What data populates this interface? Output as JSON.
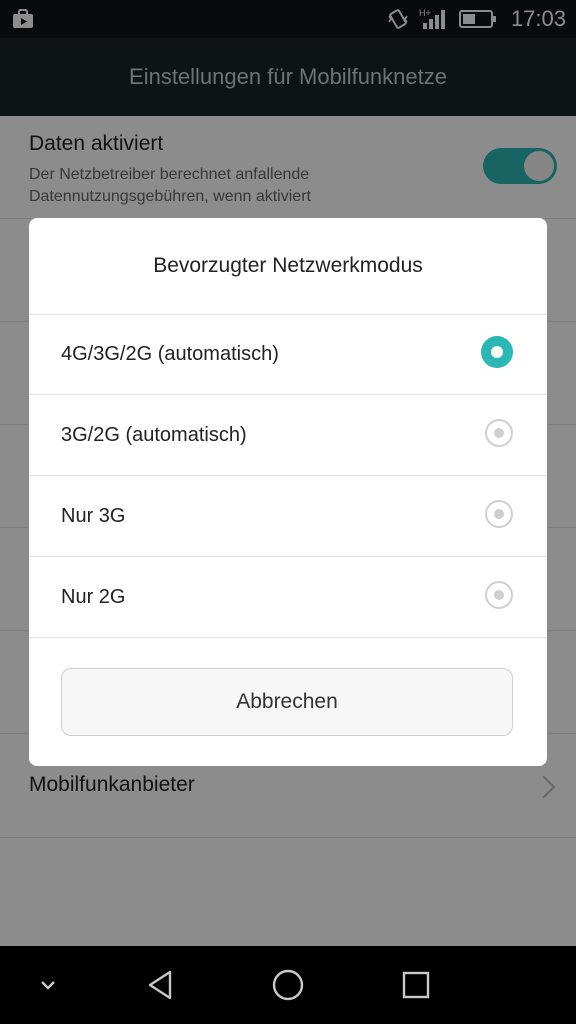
{
  "status_bar": {
    "time": "17:03",
    "icons": [
      "bag-icon",
      "vibrate-icon",
      "signal-hplus-icon",
      "battery-icon"
    ]
  },
  "action_bar": {
    "title": "Einstellungen für Mobilfunknetze"
  },
  "settings": {
    "data_enabled": {
      "title": "Daten aktiviert",
      "subtitle_line1": "Der Netzbetreiber berechnet anfallende",
      "subtitle_line2": "Datennutzungsgebühren, wenn aktiviert",
      "on": true
    },
    "carrier": {
      "title": "Mobilfunkanbieter"
    }
  },
  "dialog": {
    "title": "Bevorzugter Netzwerkmodus",
    "options": [
      {
        "label": "4G/3G/2G (automatisch)",
        "selected": true
      },
      {
        "label": "3G/2G (automatisch)",
        "selected": false
      },
      {
        "label": "Nur 3G",
        "selected": false
      },
      {
        "label": "Nur 2G",
        "selected": false
      }
    ],
    "cancel_label": "Abbrechen"
  },
  "colors": {
    "accent": "#2bb7b5",
    "toggle_on": "#1f7f7d",
    "action_bar": "#1b2329",
    "status_bar": "#111315"
  }
}
